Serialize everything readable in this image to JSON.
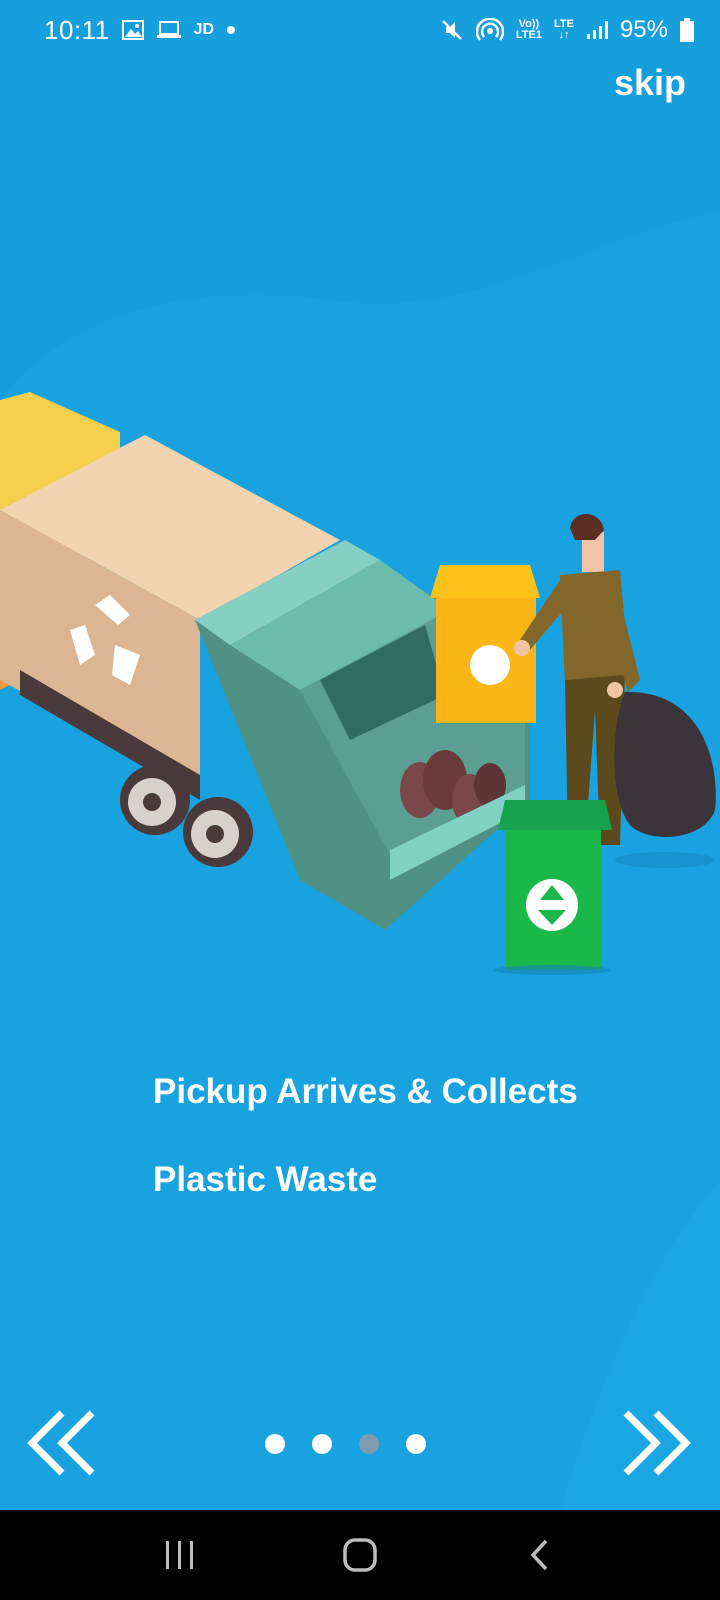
{
  "status_bar": {
    "time": "10:11",
    "carrier_label": "JD",
    "volte_label": "Vo))\nLTE1",
    "network_label": "LTE",
    "battery": "95%"
  },
  "skip_label": "skip",
  "onboarding": {
    "title_line1": "Pickup Arrives & Collects",
    "title_line2": "Plastic Waste"
  },
  "pagination": {
    "total": 4,
    "active_index": 2
  },
  "icons": {
    "prev": "double-chevron-left-icon",
    "next": "double-chevron-right-icon",
    "recents": "recents-icon",
    "home": "home-icon",
    "back": "back-icon"
  },
  "colors": {
    "background": "#169fdd",
    "dot_active": "#7f9db1",
    "nav_bar": "#000000"
  }
}
